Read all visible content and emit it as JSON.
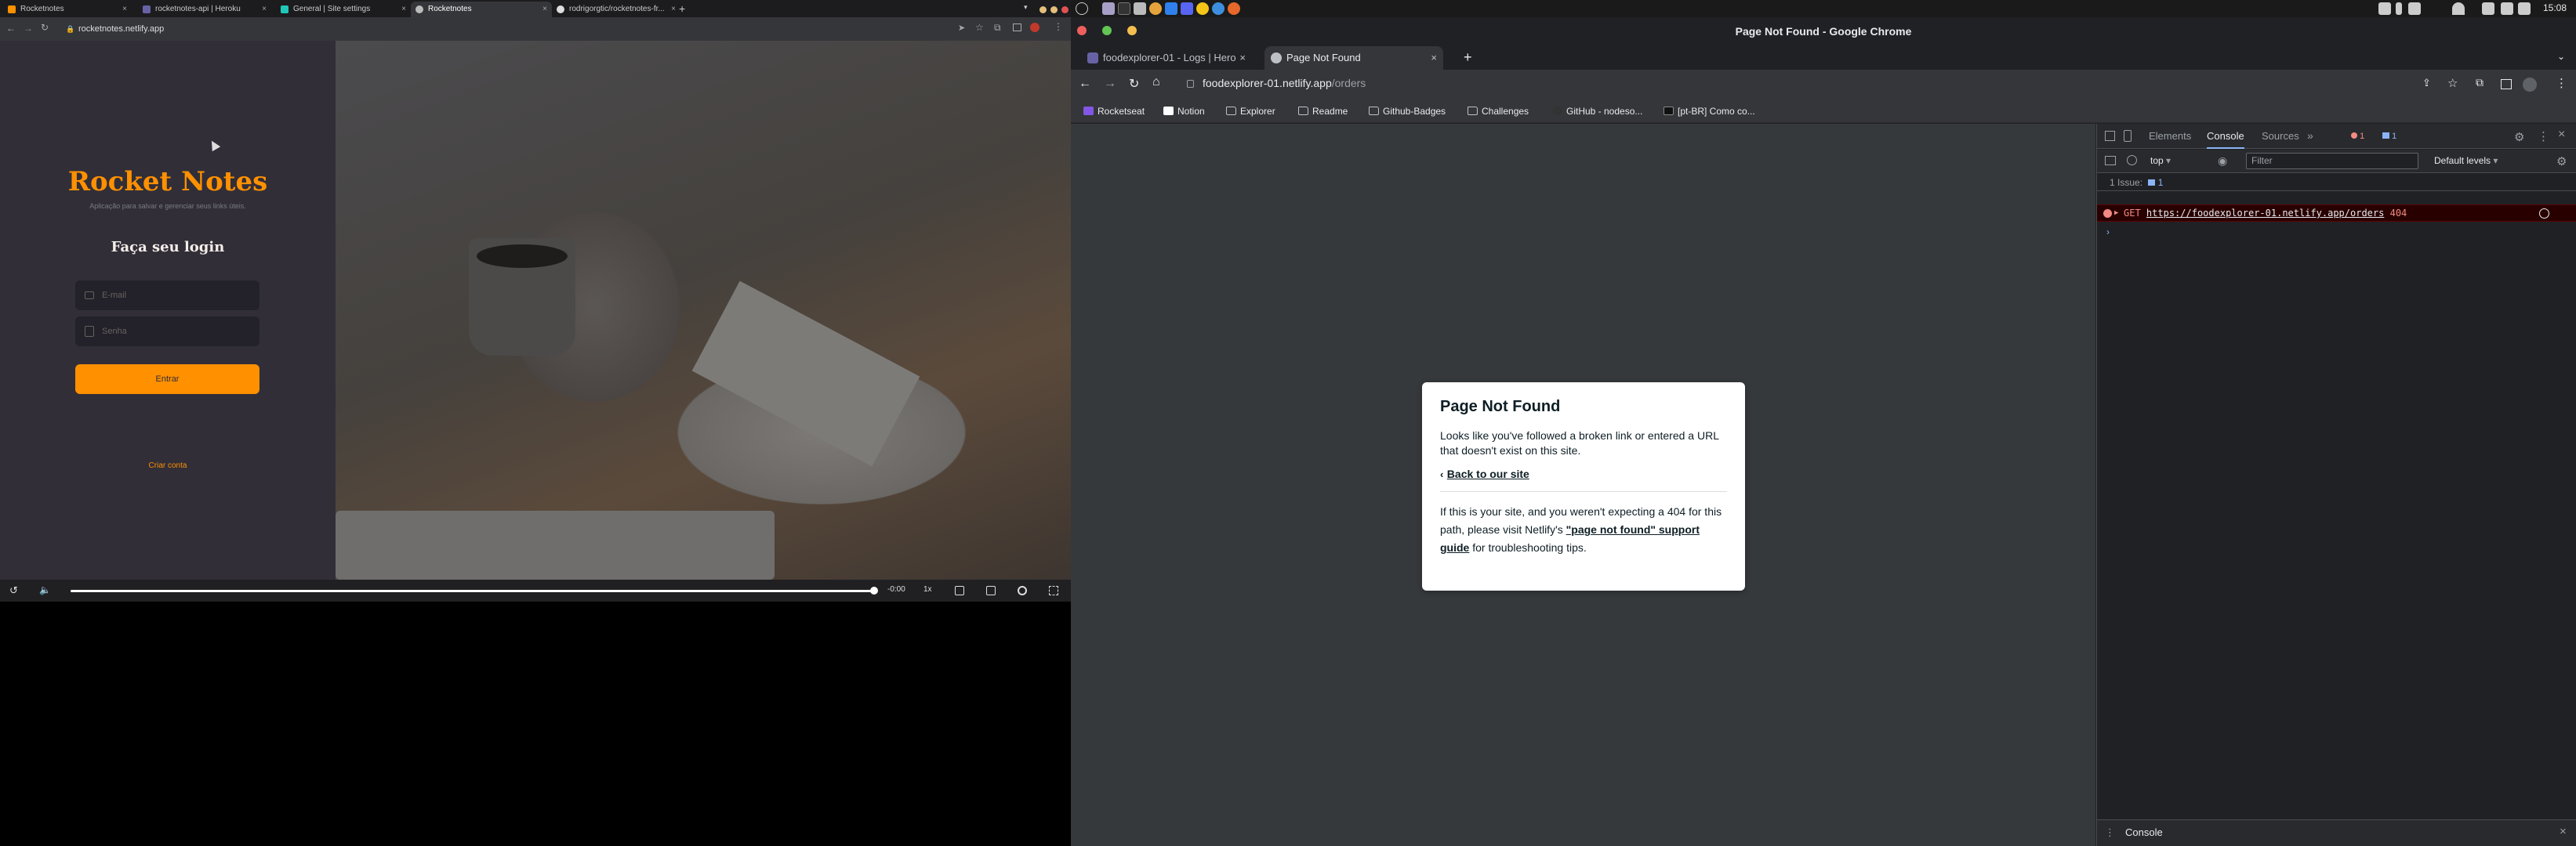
{
  "left": {
    "tabs": [
      {
        "label": "Rocketnotes"
      },
      {
        "label": "rocketnotes-api | Heroku"
      },
      {
        "label": "General | Site settings"
      },
      {
        "label": "Rocketnotes"
      },
      {
        "label": "rodrigorgtic/rocketnotes-fr..."
      }
    ],
    "url": "rocketnotes.netlify.app",
    "app": {
      "brand": "Rocket Notes",
      "subtitle": "Aplicação para salvar e gerenciar seus links úteis.",
      "login_title": "Faça seu login",
      "email_placeholder": "E-mail",
      "password_placeholder": "Senha",
      "submit_label": "Entrar",
      "create_account": "Criar conta"
    },
    "video": {
      "time": "-0:00",
      "speed": "1x"
    }
  },
  "system": {
    "clock": "15:08"
  },
  "chrome": {
    "window_title": "Page Not Found - Google Chrome",
    "tabs": [
      {
        "label": "foodexplorer-01 - Logs | Hero"
      },
      {
        "label": "Page Not Found"
      }
    ],
    "omnibox": {
      "host": "foodexplorer-01.netlify.app",
      "path": "/orders"
    },
    "bookmarks": [
      {
        "label": "Rocketseat"
      },
      {
        "label": "Notion"
      },
      {
        "label": "Explorer"
      },
      {
        "label": "Readme"
      },
      {
        "label": "Github-Badges"
      },
      {
        "label": "Challenges"
      },
      {
        "label": "GitHub - nodeso..."
      },
      {
        "label": "[pt-BR] Como co..."
      }
    ],
    "page": {
      "title": "Page Not Found",
      "message": "Looks like you've followed a broken link or entered a URL that doesn't exist on this site.",
      "back_link": "Back to our site",
      "help_prefix": "If this is your site, and you weren't expecting a 404 for this path, please visit Netlify's ",
      "help_link": "\"page not found\" support guide",
      "help_suffix": " for troubleshooting tips."
    }
  },
  "devtools": {
    "tabs": [
      {
        "label": "Elements"
      },
      {
        "label": "Console"
      },
      {
        "label": "Sources"
      }
    ],
    "error_count": "1",
    "info_count": "1",
    "context": "top",
    "filter_placeholder": "Filter",
    "levels": "Default levels",
    "issues_label": "1 Issue:",
    "issues_count": "1",
    "error": {
      "method": "GET",
      "url": "https://foodexplorer-01.netlify.app/orders",
      "status": "404"
    },
    "drawer_tab": "Console"
  }
}
